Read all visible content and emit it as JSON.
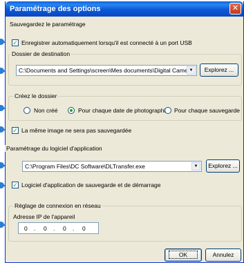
{
  "window": {
    "title": "Paramétrage des options",
    "close_glyph": "✕"
  },
  "save_settings": {
    "group_label": "Sauvegardez le paramétrage",
    "auto_save_label": "Enregistrer automatiquement lorsqu'il est connecté à un port USB",
    "auto_save_checked": true
  },
  "destination": {
    "group_label": "Dossier de destination",
    "path": "C:\\Documents and Settings\\screen\\Mes documents\\Digital Camera",
    "browse_label": "Explorez ..."
  },
  "create_folder": {
    "group_label": "Créez le dossier",
    "options": [
      "Non créé",
      "Pour chaque date de photographie",
      "Pour chaque sauvegarde"
    ],
    "selected": 1
  },
  "same_image": {
    "label": "La même image ne sera pas sauvegardée",
    "checked": true
  },
  "app_software": {
    "group_label": "Paramétrage du logiciel d'application",
    "path": "C:\\Program Files\\DC Software\\DLTransfer.exe",
    "browse_label": "Explorez ...",
    "launch_label": "Logiciel d'application de sauvegarde et de démarrage",
    "launch_checked": true
  },
  "network": {
    "group_label": "Réglage de connexion en réseau",
    "ip_label": "Adresse IP de l'appareil",
    "ip_octets": [
      "0",
      "0",
      "0",
      "0"
    ]
  },
  "footer": {
    "ok_label": "OK",
    "cancel_label": "Annulez"
  },
  "colors": {
    "callout": "#2a7fd4",
    "titlebar": "#0b58d6",
    "check": "#21a121"
  },
  "icons": {
    "checkmark": "✓",
    "dropdown": "▼"
  }
}
